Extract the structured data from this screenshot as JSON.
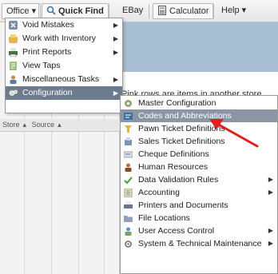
{
  "toolbar": {
    "office_label": "Office ▾",
    "quick_find_label": "Quick Find",
    "ebay_label": "EBay",
    "calculator_label": "Calculator",
    "help_label": "Help ▾"
  },
  "grid": {
    "columns": [
      "Store",
      "Source"
    ]
  },
  "notice": "Pink rows are items in another store",
  "office_menu": {
    "items": [
      {
        "label": "Void Mistakes",
        "icon": "void-icon",
        "submenu": true
      },
      {
        "label": "Work with Inventory",
        "icon": "inventory-icon",
        "submenu": true
      },
      {
        "label": "Print Reports",
        "icon": "print-reports-icon",
        "submenu": true
      },
      {
        "label": "View Taps",
        "icon": "view-taps-icon",
        "submenu": false
      },
      {
        "label": "Miscellaneous Tasks",
        "icon": "misc-tasks-icon",
        "submenu": true
      },
      {
        "label": "Configuration",
        "icon": "configuration-icon",
        "submenu": true,
        "active": true
      }
    ]
  },
  "config_menu": {
    "items": [
      {
        "label": "Master Configuration",
        "icon": "master-config-icon",
        "submenu": false
      },
      {
        "label": "Codes and Abbreviations",
        "icon": "codes-icon",
        "submenu": false,
        "highlighted": true
      },
      {
        "label": "Pawn Ticket Definitions",
        "icon": "pawn-ticket-icon",
        "submenu": false
      },
      {
        "label": "Sales Ticket Definitions",
        "icon": "sales-ticket-icon",
        "submenu": false
      },
      {
        "label": "Cheque Definitions",
        "icon": "cheque-icon",
        "submenu": false
      },
      {
        "label": "Human Resources",
        "icon": "human-resources-icon",
        "submenu": false
      },
      {
        "label": "Data Validation Rules",
        "icon": "validation-icon",
        "submenu": true
      },
      {
        "label": "Accounting",
        "icon": "accounting-icon",
        "submenu": true
      },
      {
        "label": "Printers and Documents",
        "icon": "printers-icon",
        "submenu": false
      },
      {
        "label": "File Locations",
        "icon": "file-locations-icon",
        "submenu": false
      },
      {
        "label": "User Access Control",
        "icon": "user-access-icon",
        "submenu": true
      },
      {
        "label": "System & Technical Maintenance",
        "icon": "system-maintenance-icon",
        "submenu": true
      }
    ]
  },
  "colors": {
    "active_item": "#6c7c8e",
    "highlighted_item": "#8a96a4",
    "header_band": "#a9bfd3",
    "pointer_arrow": "#e0201b"
  }
}
